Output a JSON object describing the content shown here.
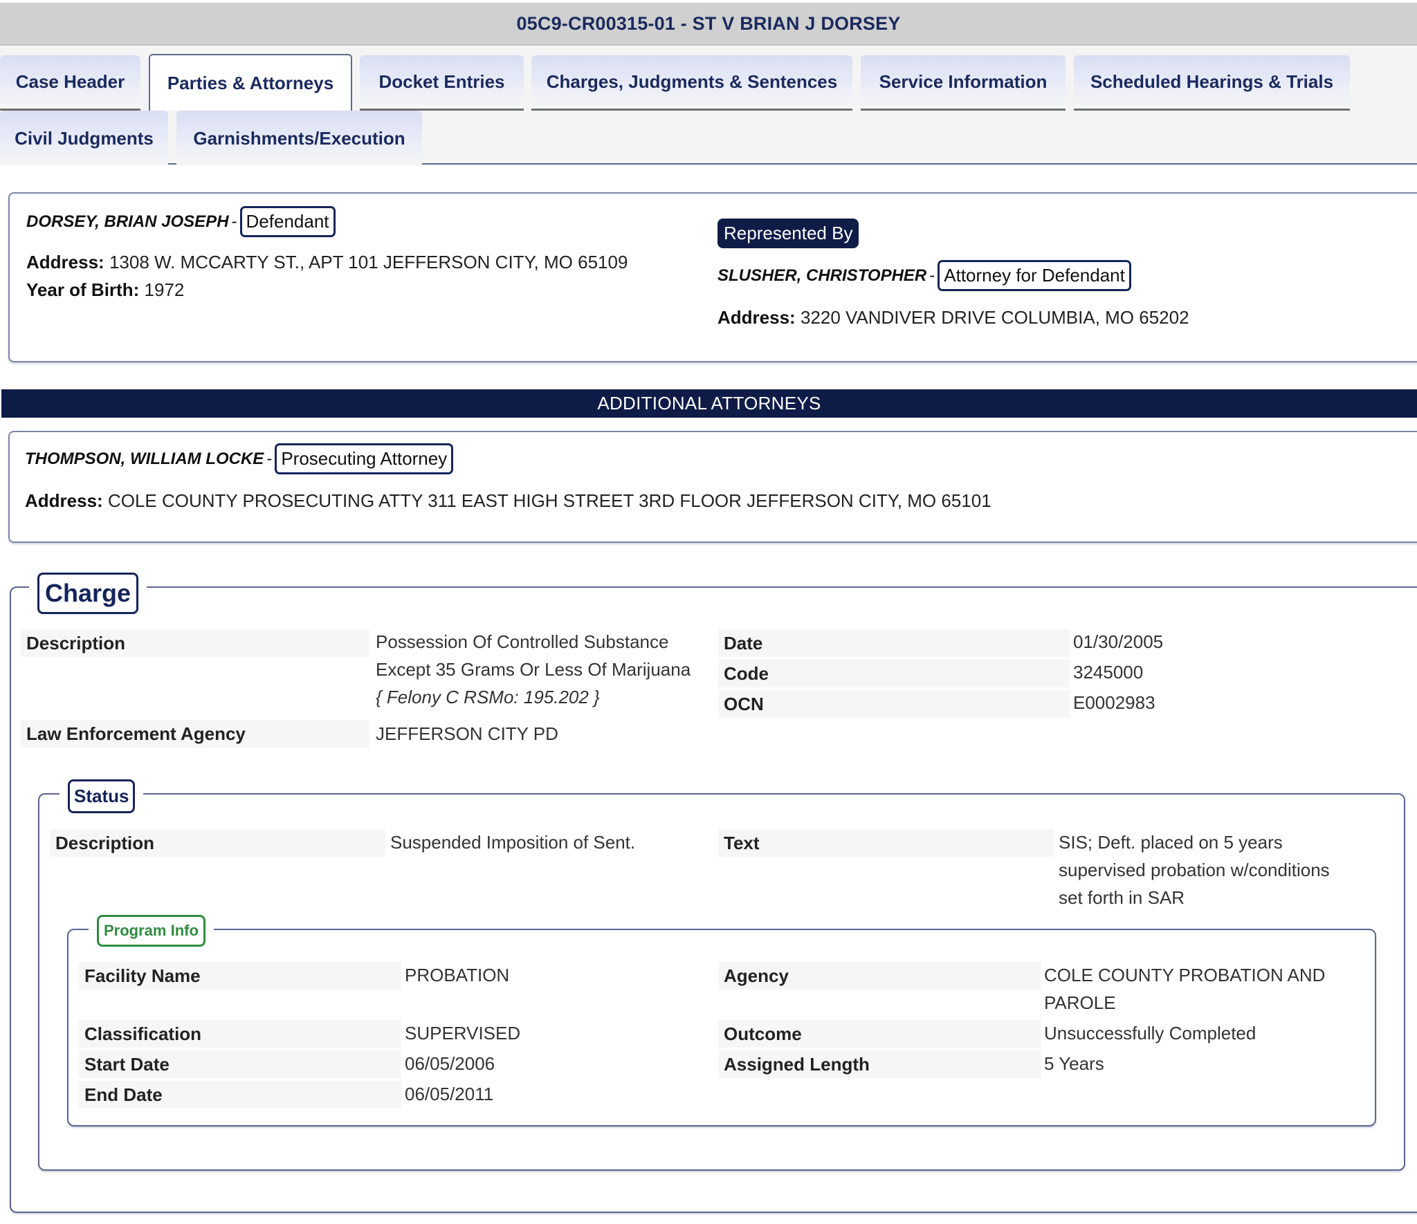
{
  "header": {
    "title": "05C9-CR00315-01 - ST V BRIAN J DORSEY"
  },
  "tabs": [
    {
      "label": "Case Header",
      "active": false
    },
    {
      "label": "Parties & Attorneys",
      "active": true
    },
    {
      "label": "Docket Entries",
      "active": false
    },
    {
      "label": "Charges, Judgments & Sentences",
      "active": false
    },
    {
      "label": "Service Information",
      "active": false
    },
    {
      "label": "Scheduled Hearings & Trials",
      "active": false
    },
    {
      "label": "Civil Judgments",
      "active": false
    },
    {
      "label": "Garnishments/Execution",
      "active": false
    }
  ],
  "defendant": {
    "name": "DORSEY, BRIAN JOSEPH",
    "separator": "-",
    "role": "Defendant",
    "address_label": "Address:",
    "address": "1308 W. MCCARTY ST., APT 101 JEFFERSON CITY, MO 65109",
    "yob_label": "Year of Birth:",
    "yob": "1972"
  },
  "represented_by": {
    "badge": "Represented By",
    "name": "SLUSHER, CHRISTOPHER",
    "separator": "-",
    "role": "Attorney for Defendant",
    "address_label": "Address:",
    "address": "3220 VANDIVER DRIVE COLUMBIA, MO 65202"
  },
  "additional_attorneys": {
    "banner": "ADDITIONAL ATTORNEYS",
    "items": [
      {
        "name": "THOMPSON, WILLIAM LOCKE",
        "separator": "-",
        "role": "Prosecuting Attorney",
        "address_label": "Address:",
        "address": "COLE COUNTY PROSECUTING ATTY 311 EAST HIGH STREET 3RD FLOOR JEFFERSON CITY, MO 65101"
      }
    ]
  },
  "charge": {
    "legend": "Charge",
    "description_label": "Description",
    "description_lines": [
      "Possession Of Controlled Substance",
      "Except 35 Grams Or Less Of Marijuana"
    ],
    "description_statute": "{ Felony C RSMo: 195.202 }",
    "agency_label": "Law Enforcement Agency",
    "agency": "JEFFERSON CITY PD",
    "date_label": "Date",
    "date": "01/30/2005",
    "code_label": "Code",
    "code": "3245000",
    "ocn_label": "OCN",
    "ocn": "E0002983"
  },
  "status": {
    "legend": "Status",
    "description_label": "Description",
    "description": "Suspended Imposition of Sent.",
    "text_label": "Text",
    "text_lines": [
      "SIS; Deft. placed on 5 years",
      "supervised probation w/conditions",
      "set forth in SAR"
    ]
  },
  "program_info": {
    "legend": "Program Info",
    "facility_label": "Facility Name",
    "facility": "PROBATION",
    "classification_label": "Classification",
    "classification": "SUPERVISED",
    "start_label": "Start Date",
    "start": "06/05/2006",
    "end_label": "End Date",
    "end": "06/05/2011",
    "agency_label": "Agency",
    "agency_lines": [
      "COLE COUNTY PROBATION AND",
      "PAROLE"
    ],
    "outcome_label": "Outcome",
    "outcome": "Unsuccessfully Completed",
    "length_label": "Assigned Length",
    "length": "5 Years"
  },
  "colors": {
    "navy": "#101c48",
    "tab_text": "#1a2a5e",
    "program_green": "#2f8c3f",
    "title_bar": "#d0d0d0"
  }
}
